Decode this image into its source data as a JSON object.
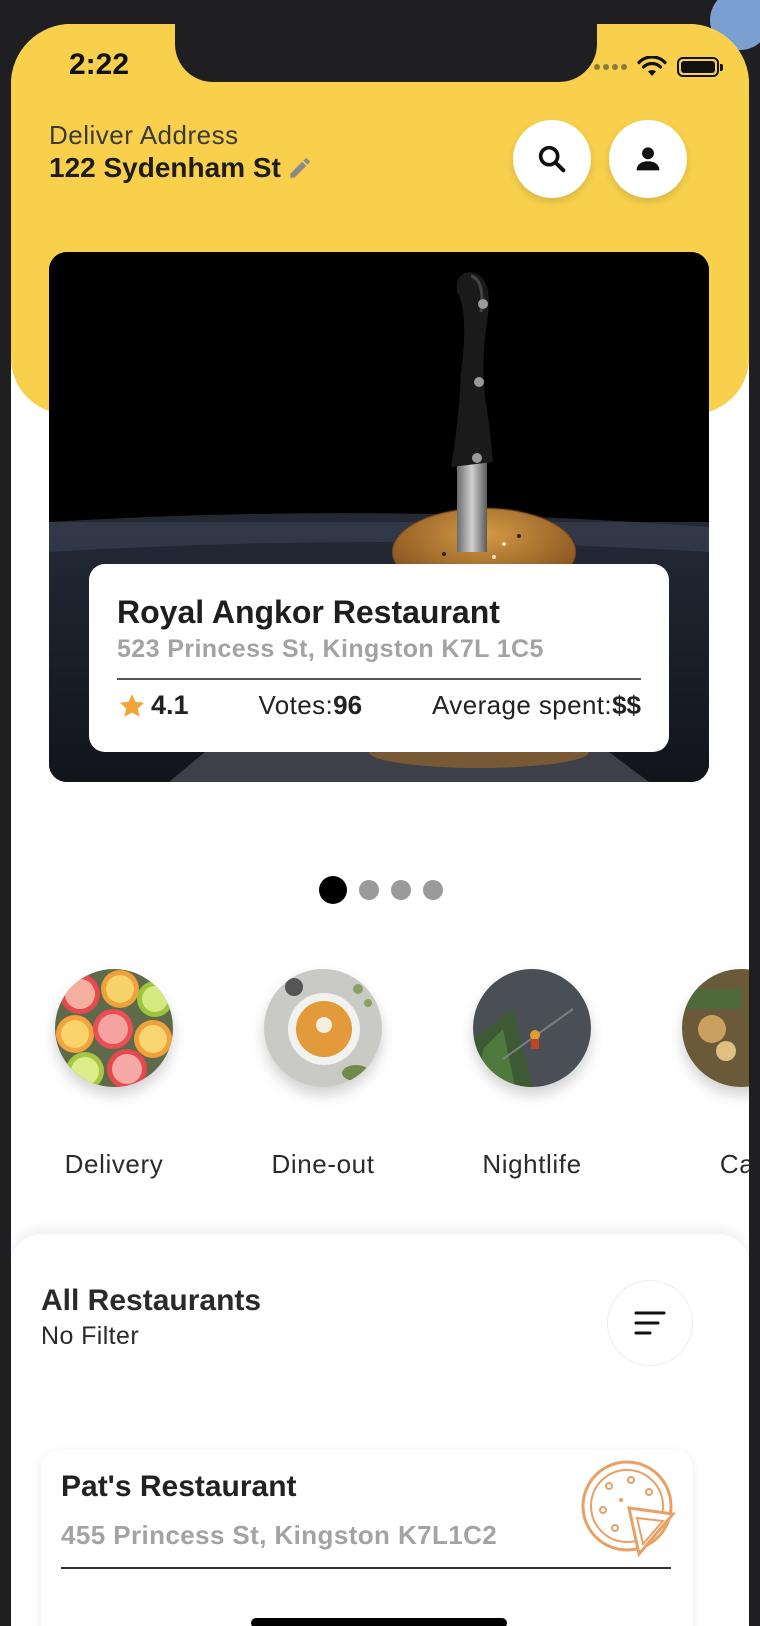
{
  "status_bar": {
    "time": "2:22"
  },
  "header": {
    "deliver_label": "Deliver Address",
    "address": "122 Sydenham St",
    "icons": {
      "search": "search-icon",
      "profile": "person-icon",
      "edit": "pencil-icon"
    },
    "accent_color": "#f8d04c"
  },
  "featured": {
    "name": "Royal Angkor Restaurant",
    "address": "523 Princess St, Kingston K7L 1C5",
    "rating": "4.1",
    "votes_label": "Votes:",
    "votes": "96",
    "avg_spent_label": "Average spent:",
    "avg_spent": "$$",
    "star_color": "#f2a53a"
  },
  "carousel": {
    "page_count": 4,
    "active_index": 0
  },
  "categories": [
    {
      "label": "Delivery",
      "image": "citrus-slices"
    },
    {
      "label": "Dine-out",
      "image": "soup-bowl"
    },
    {
      "label": "Nightlife",
      "image": "street-scene"
    },
    {
      "label": "Cat",
      "image": "market"
    }
  ],
  "restaurants": {
    "title": "All Restaurants",
    "filter_status": "No Filter",
    "items": [
      {
        "name": "Pat's Restaurant",
        "address": "455 Princess St, Kingston K7L1C2",
        "icon": "pizza-icon"
      }
    ]
  }
}
